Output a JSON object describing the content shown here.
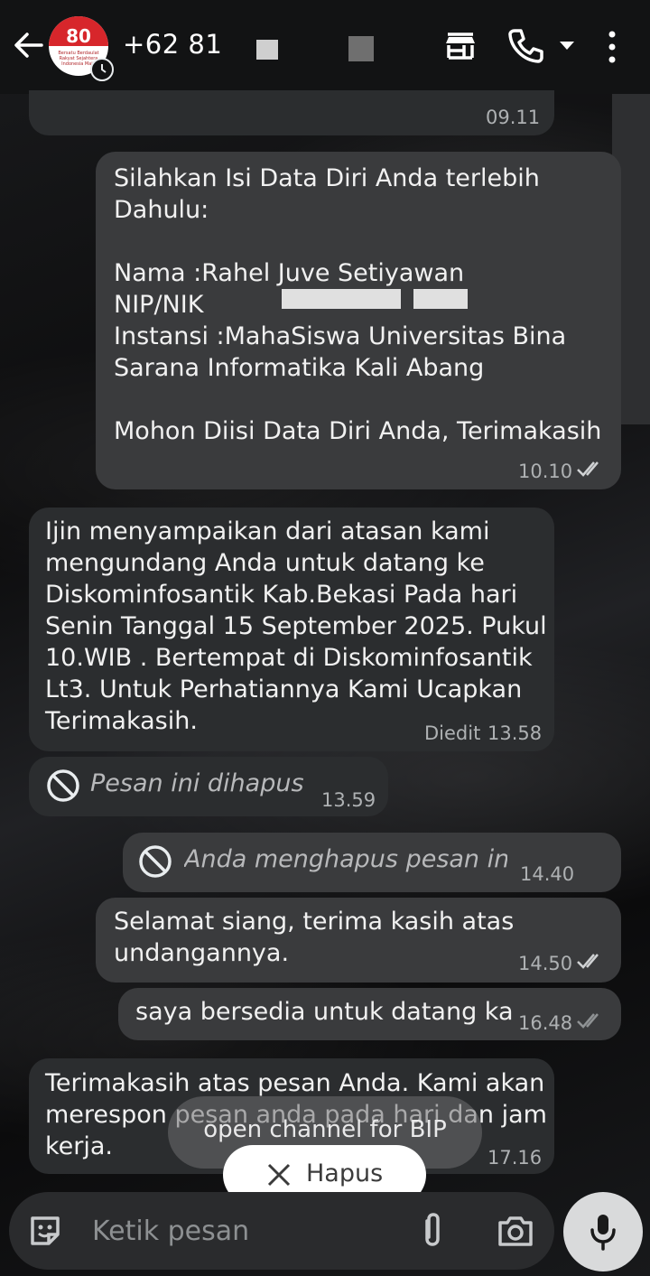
{
  "header": {
    "contact_name": "+62 81",
    "avatar_badge": "80",
    "avatar_caption": "Bersatu Berdaulat Rakyat Sejahtera Indonesia Maju"
  },
  "messages": [
    {
      "time": "09.11"
    },
    {
      "text": "Silahkan Isi Data Diri Anda terlebih\nDahulu:\n\nNama   :Rahel Juve Setiyawan\nNIP/NIK\nInstansi  :MahaSiswa Universitas Bina\nSarana Informatika Kali Abang\n\nMohon Diisi Data Diri Anda, Terimakasih",
      "time": "10.10"
    },
    {
      "text": "Ijin menyampaikan dari atasan kami\nmengundang Anda untuk datang ke\nDiskominfosantik Kab.Bekasi Pada hari\nSenin Tanggal 15 September 2025. Pukul\n10.WIB . Bertempat di Diskominfosantik\nLt3. Untuk Perhatiannya Kami Ucapkan\nTerimakasih.",
      "edited_label": "Diedit",
      "time": "13.58"
    },
    {
      "text": "Pesan ini dihapus",
      "time": "13.59"
    },
    {
      "text": "Anda menghapus pesan ini",
      "time": "14.40"
    },
    {
      "text": "Selamat siang, terima kasih atas\nundangannya.",
      "time": "14.50"
    },
    {
      "text": "saya bersedia untuk datang ka",
      "time": "16.48"
    },
    {
      "text": "Terimakasih atas pesan Anda. Kami akan\nmerespon pesan anda pada hari dan jam\nkerja.",
      "time": "17.16"
    }
  ],
  "toast": {
    "text": "open channel for BIP"
  },
  "hapus_button": {
    "label": "Hapus"
  },
  "composer": {
    "placeholder": "Ketik pesan"
  },
  "colors": {
    "incoming": "#2b2d2f",
    "outgoing": "#3a3b3d",
    "header": "#121314"
  }
}
